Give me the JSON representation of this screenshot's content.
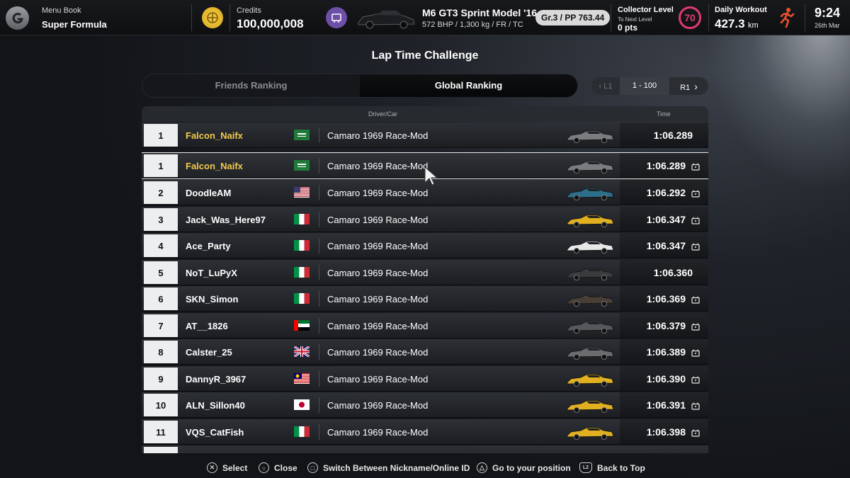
{
  "topbar": {
    "menu_book_label": "Menu Book",
    "menu_book_value": "Super Formula",
    "credits_label": "Credits",
    "credits_value": "100,000,008",
    "car_name": "M6 GT3 Sprint Model '16",
    "car_specs": "572 BHP / 1,300 kg / FR / TC",
    "car_class": "Gr.3 / PP 763.44",
    "collector_label": "Collector Level",
    "collector_sub": "To Next Level",
    "collector_pts": "0 pts",
    "collector_level": "70",
    "workout_label": "Daily Workout",
    "workout_value": "427.3",
    "workout_unit": "km",
    "time": "9:24",
    "date": "26th Mar"
  },
  "page_title": "Lap Time Challenge",
  "tabs": [
    {
      "label": "Friends Ranking",
      "active": false
    },
    {
      "label": "Global Ranking",
      "active": true
    }
  ],
  "pager": {
    "prev": "L1",
    "range": "1 - 100",
    "next": "R1"
  },
  "table": {
    "col_driver": "Driver/Car",
    "col_time": "Time"
  },
  "rows": [
    {
      "rank": "1",
      "name": "Falcon_Naifx",
      "flag": "sa",
      "car": "Camaro 1969 Race-Mod",
      "car_color": "#7a7c80",
      "time": "1:06.289",
      "replay": false,
      "me": true,
      "selected": false
    },
    {
      "rank": "1",
      "name": "Falcon_Naifx",
      "flag": "sa",
      "car": "Camaro 1969 Race-Mod",
      "car_color": "#7a7c80",
      "time": "1:06.289",
      "replay": true,
      "me": true,
      "selected": true
    },
    {
      "rank": "2",
      "name": "DoodleAM",
      "flag": "us",
      "car": "Camaro 1969 Race-Mod",
      "car_color": "#2c6f8a",
      "time": "1:06.292",
      "replay": true,
      "me": false,
      "selected": false
    },
    {
      "rank": "3",
      "name": "Jack_Was_Here97",
      "flag": "it",
      "car": "Camaro 1969 Race-Mod",
      "car_color": "#e0b020",
      "time": "1:06.347",
      "replay": true,
      "me": false,
      "selected": false
    },
    {
      "rank": "4",
      "name": "Ace_Party",
      "flag": "it",
      "car": "Camaro 1969 Race-Mod",
      "car_color": "#e8e8e8",
      "time": "1:06.347",
      "replay": true,
      "me": false,
      "selected": false
    },
    {
      "rank": "5",
      "name": "NoT_LuPyX",
      "flag": "it",
      "car": "Camaro 1969 Race-Mod",
      "car_color": "#3a3b3e",
      "time": "1:06.360",
      "replay": false,
      "me": false,
      "selected": false
    },
    {
      "rank": "6",
      "name": "SKN_Simon",
      "flag": "it",
      "car": "Camaro 1969 Race-Mod",
      "car_color": "#4a3f36",
      "time": "1:06.369",
      "replay": true,
      "me": false,
      "selected": false
    },
    {
      "rank": "7",
      "name": "AT__1826",
      "flag": "ae",
      "car": "Camaro 1969 Race-Mod",
      "car_color": "#55575b",
      "time": "1:06.379",
      "replay": true,
      "me": false,
      "selected": false
    },
    {
      "rank": "8",
      "name": "Calster_25",
      "flag": "gb",
      "car": "Camaro 1969 Race-Mod",
      "car_color": "#6a6c70",
      "time": "1:06.389",
      "replay": true,
      "me": false,
      "selected": false
    },
    {
      "rank": "9",
      "name": "DannyR_3967",
      "flag": "my",
      "car": "Camaro 1969 Race-Mod",
      "car_color": "#e0b020",
      "time": "1:06.390",
      "replay": true,
      "me": false,
      "selected": false
    },
    {
      "rank": "10",
      "name": "ALN_Sillon40",
      "flag": "jp",
      "car": "Camaro 1969 Race-Mod",
      "car_color": "#e0b020",
      "time": "1:06.391",
      "replay": true,
      "me": false,
      "selected": false
    },
    {
      "rank": "11",
      "name": "VQS_CatFish",
      "flag": "it",
      "car": "Camaro 1969 Race-Mod",
      "car_color": "#e0b020",
      "time": "1:06.398",
      "replay": true,
      "me": false,
      "selected": false
    }
  ],
  "bottombar": {
    "select": "Select",
    "close": "Close",
    "switch": "Switch Between Nickname/Online ID",
    "goto": "Go to your position",
    "back_top": "Back to Top"
  }
}
